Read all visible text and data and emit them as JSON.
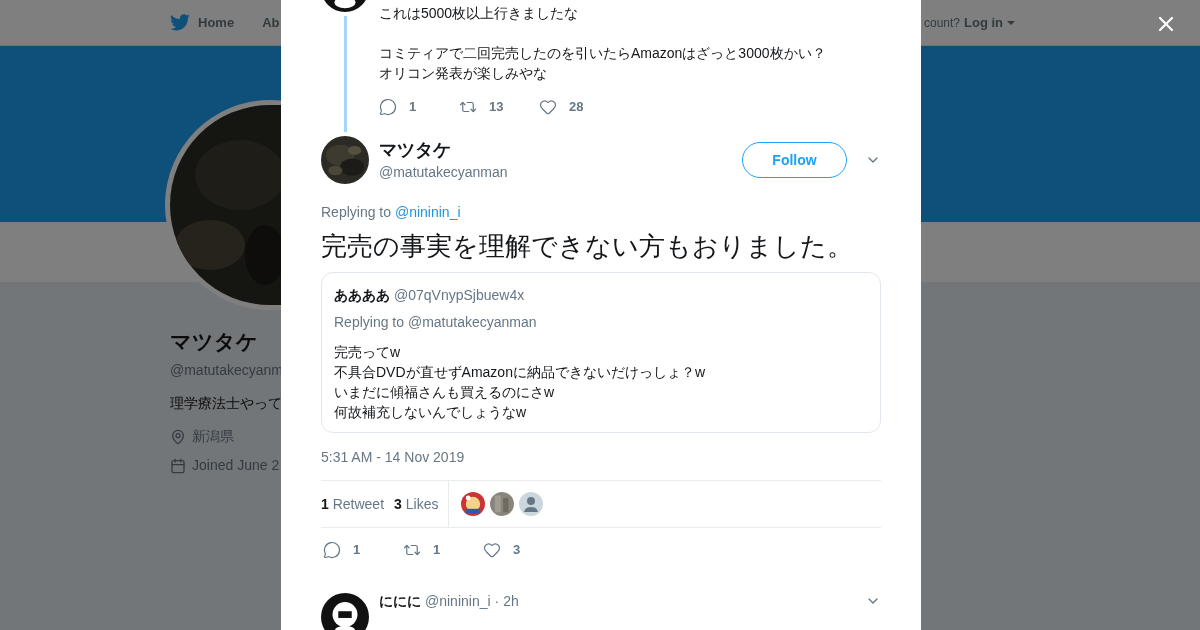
{
  "background": {
    "nav": {
      "items": [
        {
          "label": "Home",
          "kind": "home"
        },
        {
          "label": "Ab",
          "kind": "plain"
        }
      ],
      "account_prompt": "count?",
      "login": "Log in"
    },
    "profile": {
      "name": "マツタケ",
      "handle": "@matutakecyanm",
      "bio": "理学療法士やって",
      "location": "新潟県",
      "joined": "Joined June 2"
    }
  },
  "modal": {
    "previous_tweet": {
      "paragraphs": [
        [
          "これは5000枚以上行きましたな"
        ],
        [
          "コミティアで二回完売したのを引いたらAmazonはざっと3000枚かい？",
          "オリコン発表が楽しみやな"
        ]
      ],
      "actions": [
        {
          "kind": "reply",
          "count": "1"
        },
        {
          "kind": "retweet",
          "count": "13"
        },
        {
          "kind": "like",
          "count": "28"
        }
      ]
    },
    "tweet": {
      "name": "マツタケ",
      "handle": "@matutakecyanman",
      "follow": "Follow",
      "replying_prefix": "Replying to",
      "replying_handle": "@nininin_i",
      "text": "完売の事実を理解できない方もおりました。",
      "quote": {
        "name": "ああああ",
        "handle": "@07qVnypSjbuew4x",
        "replying": "Replying to @matutakecyanman",
        "lines": [
          "完売ってw",
          "不具合DVDが直せずAmazonに納品できないだけっしょ？w",
          "いまだに傾福さんも買えるのにさw",
          "何故補充しないんでしょうなw"
        ]
      },
      "timestamp": "5:31 AM - 14 Nov 2019",
      "stats": [
        {
          "count": "1",
          "label": "Retweet"
        },
        {
          "count": "3",
          "label": "Likes"
        }
      ],
      "likers": [
        {
          "kind": "picture"
        },
        {
          "kind": "picture"
        },
        {
          "kind": "default"
        }
      ],
      "actions": [
        {
          "kind": "reply",
          "count": "1"
        },
        {
          "kind": "retweet",
          "count": "1"
        },
        {
          "kind": "like",
          "count": "3"
        }
      ]
    },
    "reply": {
      "name": "ににに",
      "handle": "@nininin_i",
      "time": "· 2h"
    }
  }
}
